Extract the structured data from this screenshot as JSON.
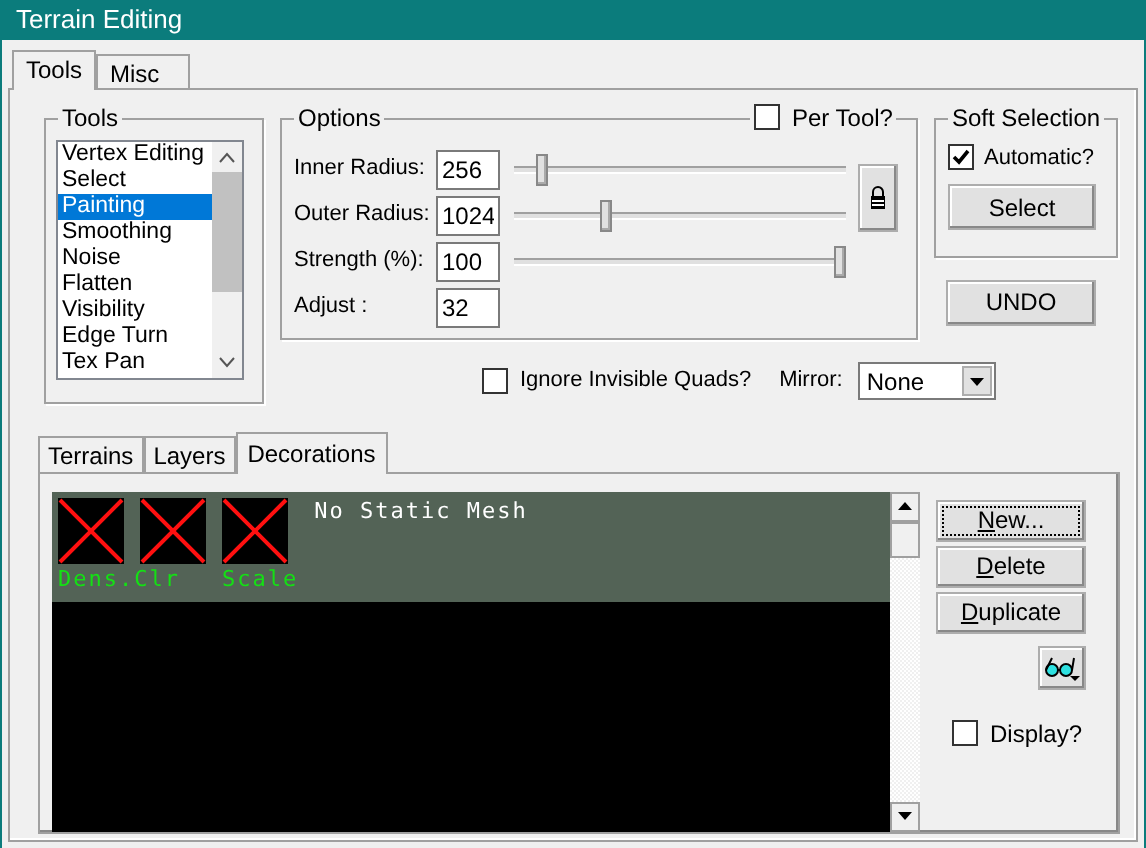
{
  "window": {
    "title": "Terrain Editing"
  },
  "tabs": [
    {
      "label": "Tools",
      "selected": true
    },
    {
      "label": "Misc",
      "selected": false
    }
  ],
  "tools": {
    "title": "Tools",
    "items": [
      {
        "label": "Vertex Editing",
        "selected": false
      },
      {
        "label": "Select",
        "selected": false
      },
      {
        "label": "Painting",
        "selected": true
      },
      {
        "label": "Smoothing",
        "selected": false
      },
      {
        "label": "Noise",
        "selected": false
      },
      {
        "label": "Flatten",
        "selected": false
      },
      {
        "label": "Visibility",
        "selected": false
      },
      {
        "label": "Edge Turn",
        "selected": false
      },
      {
        "label": "Tex Pan",
        "selected": false
      }
    ]
  },
  "options": {
    "title": "Options",
    "per_tool": {
      "label": "Per Tool?",
      "checked": false
    },
    "rows": [
      {
        "label": "Inner Radius:",
        "value": "256",
        "kind": "slider",
        "level": 0.07
      },
      {
        "label": "Outer Radius:",
        "value": "1024",
        "kind": "slider",
        "level": 0.27
      },
      {
        "label": "Strength (%):",
        "value": "100",
        "kind": "slider",
        "level": 1
      },
      {
        "label": "Adjust :",
        "value": "32",
        "kind": "plain"
      }
    ]
  },
  "soft_selection": {
    "title": "Soft Selection",
    "automatic": {
      "label": "Automatic?",
      "checked": true
    },
    "button": "Select"
  },
  "undo_button": "UNDO",
  "ignore_invisible": {
    "label": "Ignore Invisible Quads?",
    "checked": false
  },
  "mirror": {
    "label": "Mirror:",
    "value": "None"
  },
  "sub_tabs": [
    {
      "label": "Terrains",
      "selected": false
    },
    {
      "label": "Layers",
      "selected": false
    },
    {
      "label": "Decorations",
      "selected": true
    }
  ],
  "decoration": {
    "thumbnails": [
      {
        "kind": "missing"
      },
      {
        "kind": "missing"
      },
      {
        "kind": "missing"
      }
    ],
    "labels": [
      "Dens.Clr",
      "Scale"
    ],
    "mesh": "No Static Mesh"
  },
  "actions": [
    "New...",
    "Delete",
    "Duplicate"
  ],
  "display": {
    "label": "Display?",
    "checked": false
  }
}
